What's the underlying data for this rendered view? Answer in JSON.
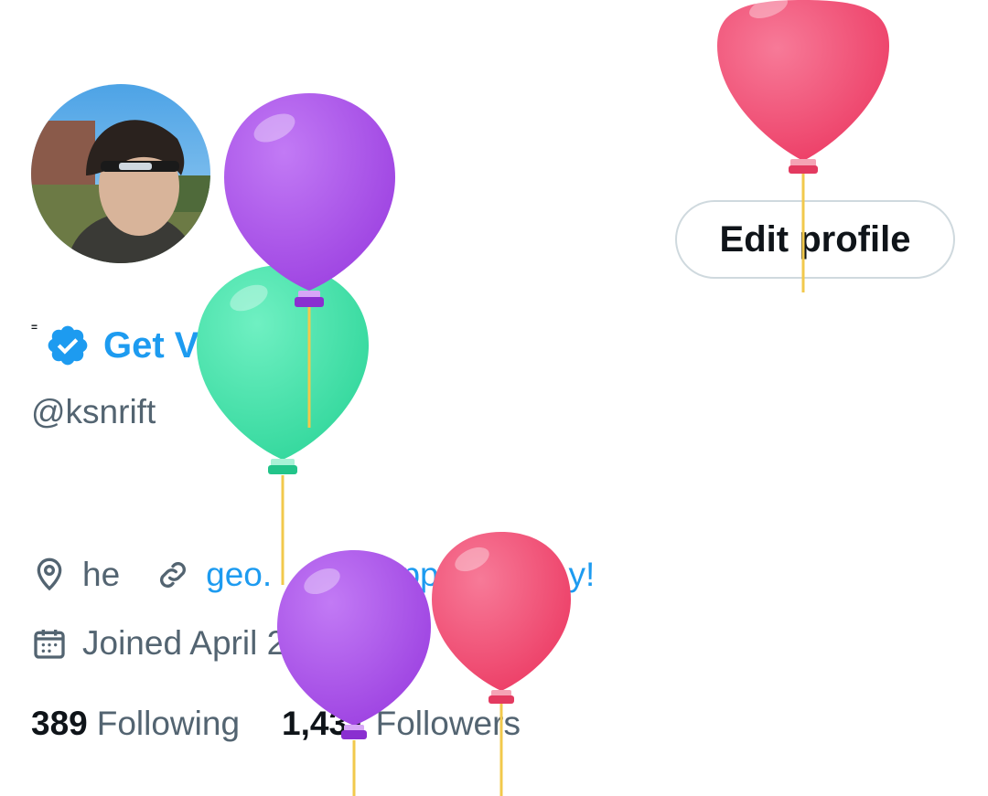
{
  "profile": {
    "avatar_alt": "profile photo",
    "edit_button_label": "Edit profile",
    "display_name": "=",
    "get_verified_label": "Get Verified",
    "handle": "@ksnrift"
  },
  "meta": {
    "location": "he",
    "website": "geo.",
    "birthday": "Happy birthday!",
    "joined": "Joined April 2022"
  },
  "stats": {
    "following_count": "389",
    "following_label": "Following",
    "followers_count": "1,431",
    "followers_label": "Followers"
  },
  "colors": {
    "accent": "#1d9bf0",
    "secondary_text": "#536471",
    "primary_text": "#0f1419",
    "button_border": "#cfd9de",
    "balloon_purple": "#a64ee6",
    "balloon_green": "#3ee0a8",
    "balloon_pink": "#f0466e",
    "balloon_string": "#f2c94c"
  },
  "icons": [
    "verified-badge-icon",
    "location-icon",
    "link-icon",
    "balloon-icon",
    "calendar-icon"
  ]
}
